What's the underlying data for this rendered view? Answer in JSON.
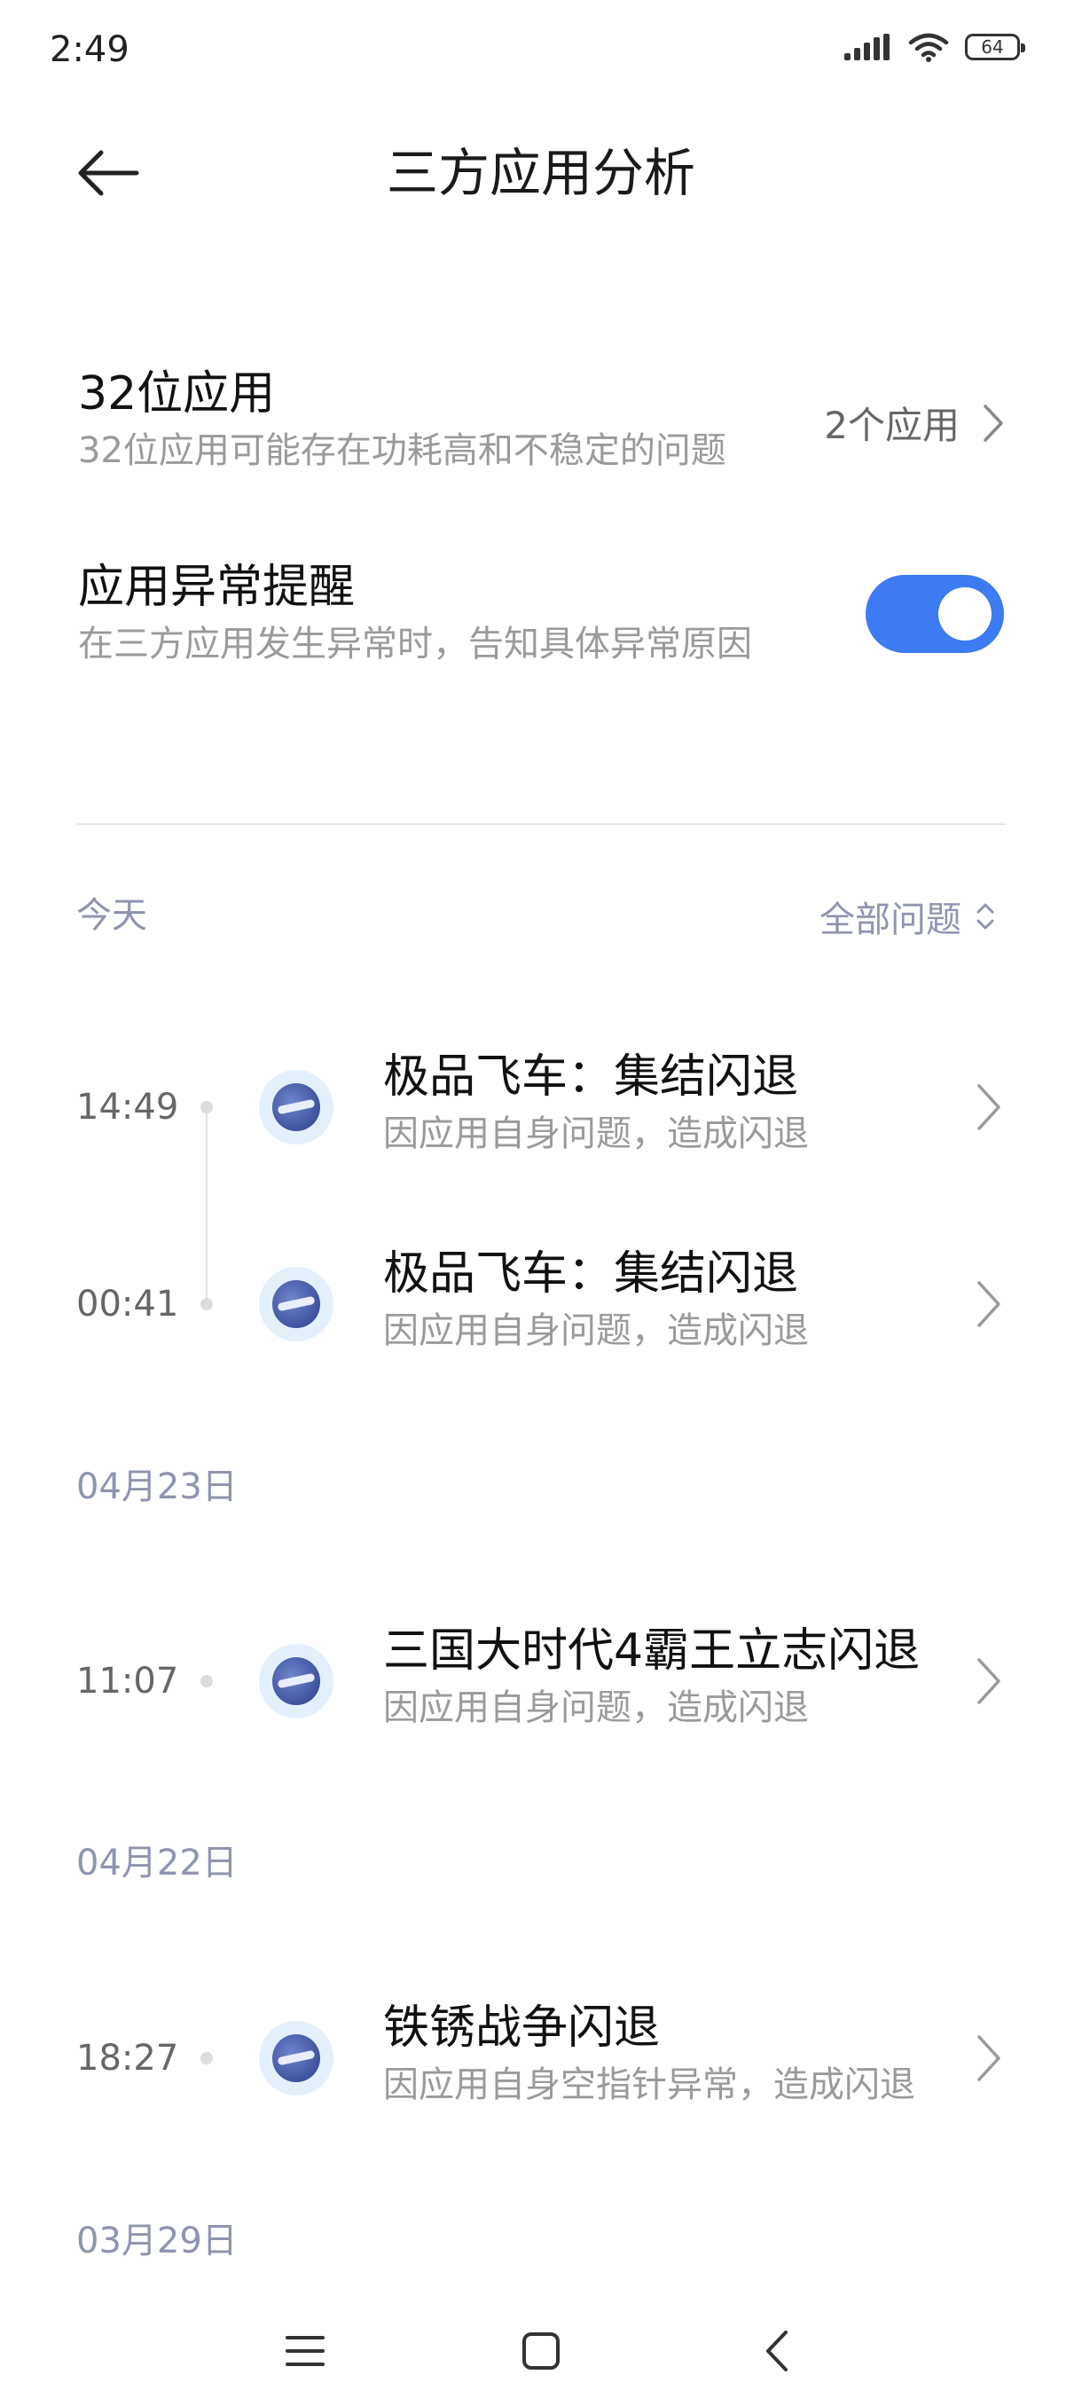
{
  "status_bar": {
    "time": "2:49",
    "battery": "64",
    "icons": [
      "signal-icon",
      "wifi-icon",
      "battery-icon"
    ]
  },
  "header": {
    "title": "三方应用分析",
    "back_icon": "back-arrow-icon"
  },
  "settings": {
    "app32": {
      "title": "32位应用",
      "desc": "32位应用可能存在功耗高和不稳定的问题",
      "value": "2个应用"
    },
    "alert": {
      "title": "应用异常提醒",
      "desc": "在三方应用发生异常时，告知具体异常原因",
      "enabled": true
    }
  },
  "filter": {
    "label": "全部问题",
    "icon": "updown-chevron-icon"
  },
  "sections": [
    {
      "label": "今天",
      "events": [
        {
          "time": "14:49",
          "title": "极品飞车：集结闪退",
          "desc": "因应用自身问题，造成闪退"
        },
        {
          "time": "00:41",
          "title": "极品飞车：集结闪退",
          "desc": "因应用自身问题，造成闪退"
        }
      ]
    },
    {
      "label": "04月23日",
      "events": [
        {
          "time": "11:07",
          "title": "三国大时代4霸王立志闪退",
          "desc": "因应用自身问题，造成闪退"
        }
      ]
    },
    {
      "label": "04月22日",
      "events": [
        {
          "time": "18:27",
          "title": "铁锈战争闪退",
          "desc": "因应用自身空指针异常，造成闪退"
        }
      ]
    },
    {
      "label": "03月29日",
      "events": []
    }
  ],
  "nav_bar": {
    "icons": [
      "menu-icon",
      "home-icon",
      "back-icon"
    ]
  }
}
